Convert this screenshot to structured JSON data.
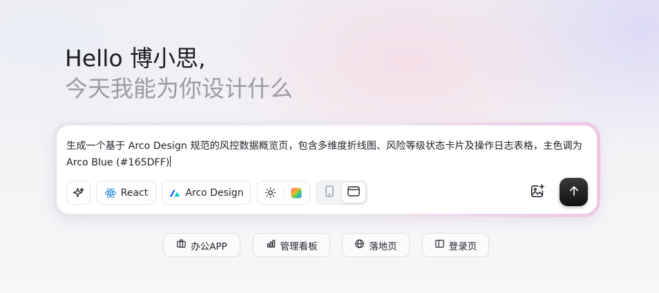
{
  "greeting": {
    "hello": "Hello 博小思,",
    "subtitle": "今天我能为你设计什么"
  },
  "prompt": {
    "text": "生成一个基于 Arco Design 规范的风控数据概览页，包含多维度折线图、风险等级状态卡片及操作日志表格，主色调为 Arco Blue (#165DFF)"
  },
  "toolbar": {
    "magic_icon": "sparkle-icon",
    "framework_label": "React",
    "framework_icon": "react-icon",
    "design_label": "Arco Design",
    "design_icon": "arco-design-icon",
    "theme_icon": "sun-icon",
    "palette_icon": "color-palette-icon",
    "device_options": [
      "mobile",
      "desktop"
    ],
    "device_selected": "desktop",
    "upload_icon": "image-add-icon",
    "send_icon": "arrow-up-icon"
  },
  "quick_templates": [
    {
      "label": "办公APP",
      "icon": "briefcase-icon"
    },
    {
      "label": "管理看板",
      "icon": "bar-chart-icon"
    },
    {
      "label": "落地页",
      "icon": "globe-icon"
    },
    {
      "label": "登录页",
      "icon": "layout-icon"
    }
  ],
  "colors": {
    "accent": "#165DFF",
    "send_button": "#1a1a1c"
  }
}
